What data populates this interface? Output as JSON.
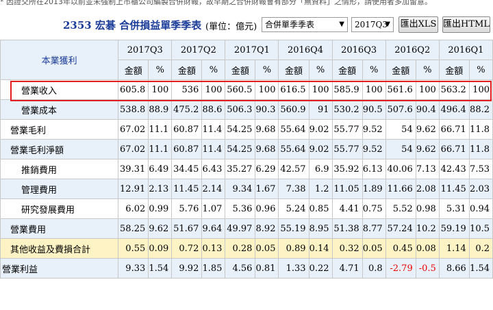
{
  "notice": "* 因證交所在2013年以前並未強制上市櫃公司編製合併財報，故早期之合併財報會有部分「無資料」之情形，請使用者多加留意。",
  "header": {
    "title": "2353 宏碁  合併損益單季季表",
    "unit": "(單位：億元)",
    "report_select": "合併單季季表",
    "period_select": "2017Q3",
    "export_xls": "匯出XLS",
    "export_html": "匯出HTML"
  },
  "table": {
    "row_header": "本業獲利",
    "periods": [
      "2017Q3",
      "2017Q2",
      "2017Q1",
      "2016Q4",
      "2016Q3",
      "2016Q2",
      "2016Q1"
    ],
    "amount_label": "金額",
    "pct_label": "%",
    "rows": [
      {
        "label": "營業收入",
        "cells": [
          "605.8",
          "100",
          "536",
          "100",
          "560.5",
          "100",
          "616.5",
          "100",
          "585.9",
          "100",
          "561.6",
          "100",
          "563.2",
          "100"
        ]
      },
      {
        "label": "營業成本",
        "cells": [
          "538.8",
          "88.9",
          "475.2",
          "88.6",
          "506.3",
          "90.3",
          "560.9",
          "91",
          "530.2",
          "90.5",
          "507.6",
          "90.4",
          "496.4",
          "88.2"
        ]
      },
      {
        "label": "營業毛利",
        "cells": [
          "67.02",
          "11.1",
          "60.87",
          "11.4",
          "54.25",
          "9.68",
          "55.64",
          "9.02",
          "55.77",
          "9.52",
          "54",
          "9.62",
          "66.71",
          "11.8"
        ]
      },
      {
        "label": "營業毛利淨額",
        "cells": [
          "67.02",
          "11.1",
          "60.87",
          "11.4",
          "54.25",
          "9.68",
          "55.64",
          "9.02",
          "55.77",
          "9.52",
          "54",
          "9.62",
          "66.71",
          "11.8"
        ]
      },
      {
        "label": "推銷費用",
        "cells": [
          "39.31",
          "6.49",
          "34.45",
          "6.43",
          "35.27",
          "6.29",
          "42.57",
          "6.9",
          "35.92",
          "6.13",
          "40.06",
          "7.13",
          "42.43",
          "7.53"
        ]
      },
      {
        "label": "管理費用",
        "cells": [
          "12.91",
          "2.13",
          "11.45",
          "2.14",
          "9.34",
          "1.67",
          "7.38",
          "1.2",
          "11.05",
          "1.89",
          "11.66",
          "2.08",
          "11.45",
          "2.03"
        ]
      },
      {
        "label": "研究發展費用",
        "cells": [
          "6.02",
          "0.99",
          "5.76",
          "1.07",
          "5.36",
          "0.96",
          "5.24",
          "0.85",
          "4.41",
          "0.75",
          "5.52",
          "0.98",
          "5.31",
          "0.94"
        ]
      },
      {
        "label": "營業費用",
        "cells": [
          "58.25",
          "9.62",
          "51.67",
          "9.64",
          "49.97",
          "8.92",
          "55.19",
          "8.95",
          "51.38",
          "8.77",
          "57.24",
          "10.2",
          "59.19",
          "10.5"
        ]
      },
      {
        "label": "其他收益及費損合計",
        "cells": [
          "0.55",
          "0.09",
          "0.72",
          "0.13",
          "0.28",
          "0.05",
          "0.89",
          "0.14",
          "0.32",
          "0.05",
          "0.45",
          "0.08",
          "1.14",
          "0.2"
        ]
      },
      {
        "label": "營業利益",
        "cells": [
          "9.33",
          "1.54",
          "9.92",
          "1.85",
          "4.56",
          "0.81",
          "1.33",
          "0.22",
          "4.71",
          "0.8",
          "-2.79",
          "-0.5",
          "8.66",
          "1.54"
        ]
      }
    ]
  }
}
